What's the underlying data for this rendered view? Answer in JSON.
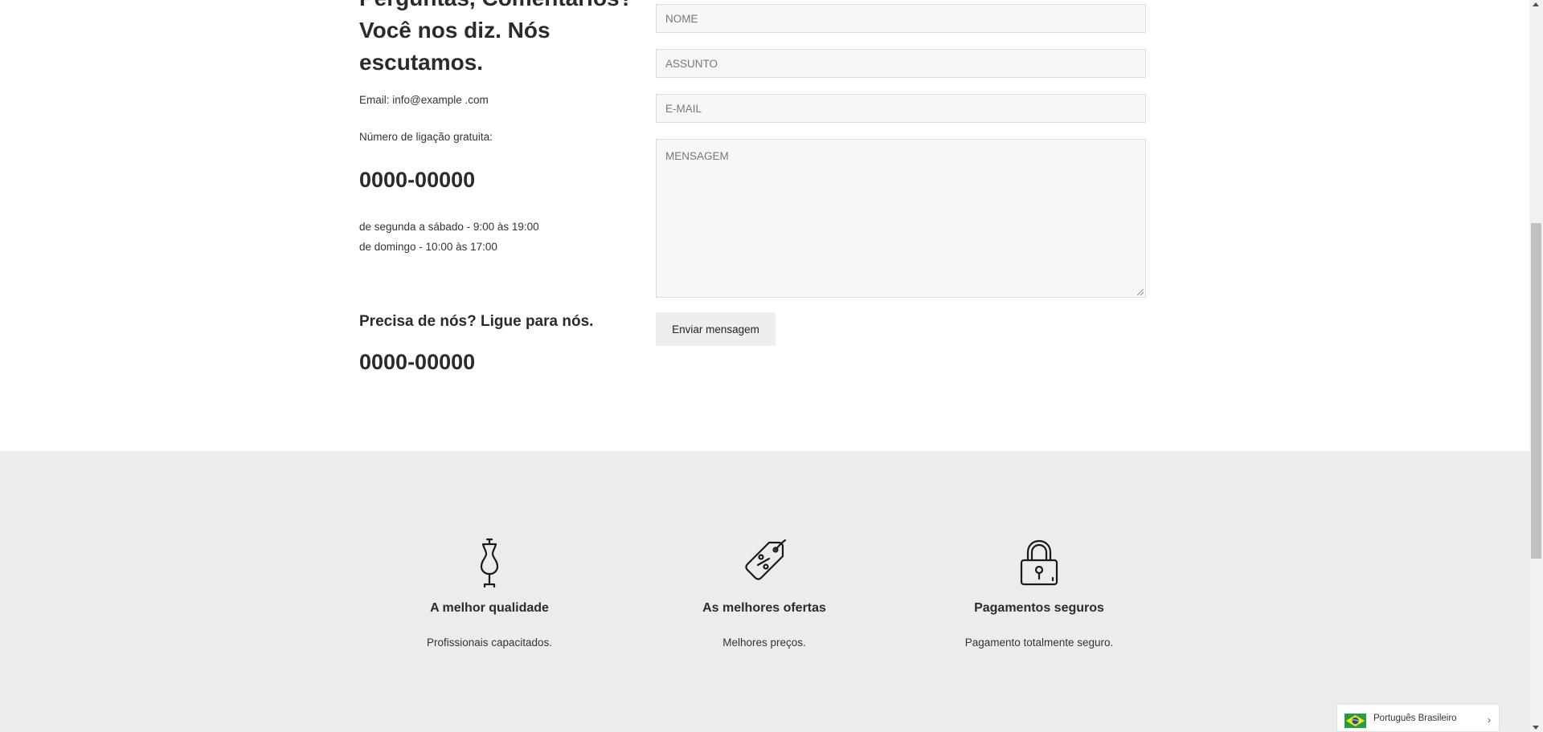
{
  "contact": {
    "heading_lines": [
      "Perguntas, Comentários?",
      "Você nos diz. Nós",
      "escutamos."
    ],
    "email": "Email: info@example .com",
    "toll_free_label": "Número de ligação gratuita:",
    "phone_1": "0000-00000",
    "hours_weekdays": "de segunda a sábado - 9:00 às 19:00",
    "hours_sunday": "de domingo - 10:00 às 17:00",
    "need_us": "Precisa de nós? Ligue para nós.",
    "phone_2": "0000-00000"
  },
  "form": {
    "name_placeholder": "NOME",
    "subject_placeholder": "ASSUNTO",
    "email_placeholder": "E-MAIL",
    "message_placeholder": "MENSAGEM",
    "submit_label": "Enviar mensagem"
  },
  "features": [
    {
      "icon": "mannequin-icon",
      "title": "A melhor qualidade",
      "desc": "Profissionais capacitados."
    },
    {
      "icon": "discount-tag-icon",
      "title": "As melhores ofertas",
      "desc": "Melhores preços."
    },
    {
      "icon": "padlock-icon",
      "title": "Pagamentos seguros",
      "desc": "Pagamento totalmente seguro."
    }
  ],
  "language": {
    "label": "Português Brasileiro",
    "flag": "brazil-flag-icon"
  },
  "colors": {
    "features_bg": "#ececed",
    "button_bg": "#eeeeee",
    "field_bg": "#f7f7f7"
  }
}
